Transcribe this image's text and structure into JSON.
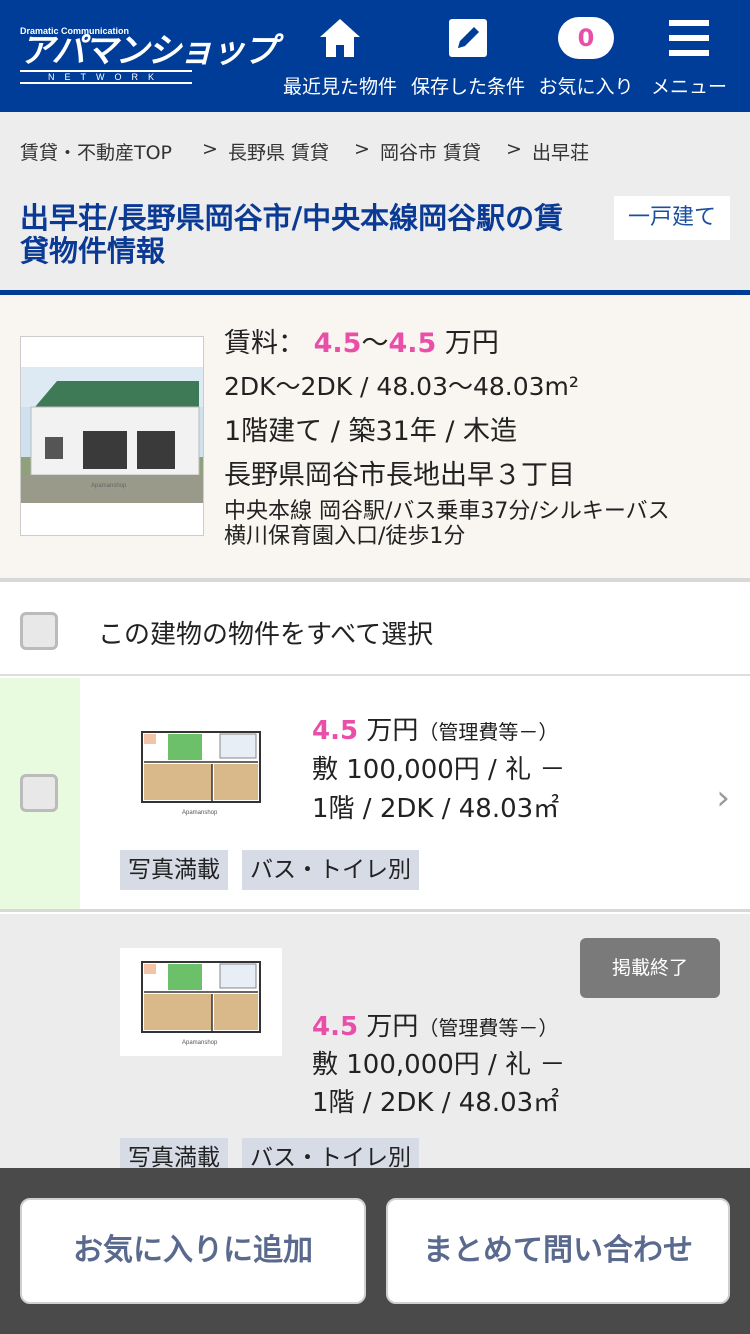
{
  "header": {
    "logo_top": "Dramatic Communication",
    "logo_main": "アパマンショップ",
    "logo_sub": "NETWORK",
    "nav": [
      {
        "label": "最近見た物件",
        "icon": "home-icon"
      },
      {
        "label": "保存した条件",
        "icon": "pencil-icon"
      },
      {
        "label": "お気に入り",
        "icon": "favorite-count-badge",
        "count": "0"
      },
      {
        "label": "メニュー",
        "icon": "hamburger-menu-icon"
      }
    ]
  },
  "breadcrumb": {
    "items": [
      "賃貸・不動産TOP",
      "長野県 賃貸",
      "岡谷市 賃貸",
      "出早荘"
    ],
    "separator": ">"
  },
  "property": {
    "title": "出早荘/長野県岡谷市/中央本線岡谷駅の賃貸物件情報",
    "type": "一戸建て",
    "rent_label": "賃料：",
    "rent_min": "4.5",
    "rent_tilde": "～",
    "rent_max": "4.5",
    "rent_unit": "万円",
    "layout_area": "2DK～2DK / 48.03～48.03m²",
    "floors_age_structure": "1階建て / 築31年 / 木造",
    "address": "長野県岡谷市長地出早３丁目",
    "access": "中央本線 岡谷駅/バス乗車37分/シルキーバス 横川保育園入口/徒歩1分",
    "photo_watermark": "Apamanshop"
  },
  "select_all_label": "この建物の物件をすべて選択",
  "units": [
    {
      "rent": "4.5",
      "rent_unit": "万円",
      "mgmt": "（管理費等－）",
      "deposit": "敷 100,000円 / 礼 －",
      "floor_layout": "1階 / 2DK / 48.03㎡",
      "tags": [
        "写真満載",
        "バス・トイレ別"
      ],
      "status": ""
    },
    {
      "rent": "4.5",
      "rent_unit": "万円",
      "mgmt": "（管理費等－）",
      "deposit": "敷 100,000円 / 礼 －",
      "floor_layout": "1階 / 2DK / 48.03㎡",
      "tags": [
        "写真満載",
        "バス・トイレ別"
      ],
      "status": "掲載終了"
    }
  ],
  "floorplan_watermark": "Apamanshop",
  "bottom_bar": {
    "favorite_button": "お気に入りに追加",
    "inquiry_button": "まとめて問い合わせ"
  },
  "colors": {
    "brand_blue": "#003d99",
    "accent_pink": "#e94fa8",
    "title_blue": "#0a3a94"
  }
}
